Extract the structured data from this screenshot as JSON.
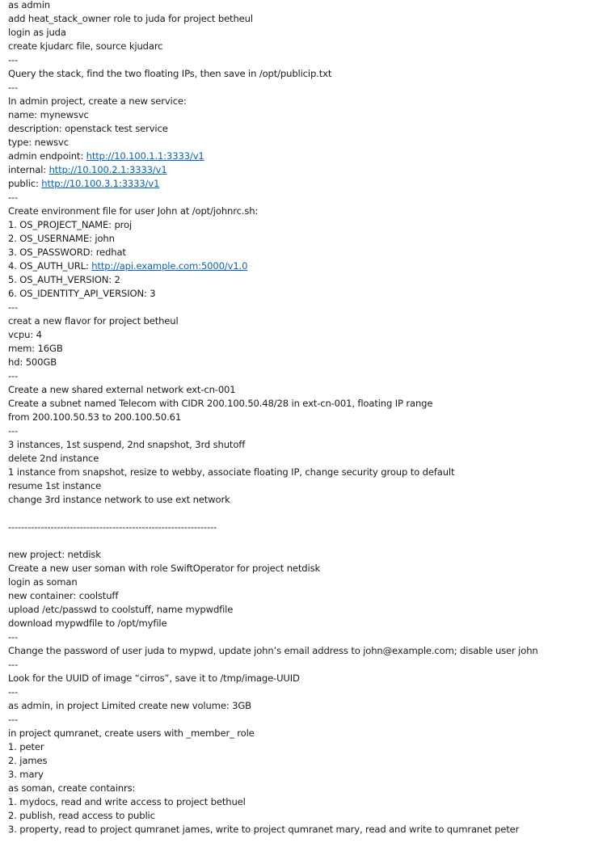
{
  "lines": [
    [
      {
        "t": "as admin"
      }
    ],
    [
      {
        "t": "add heat_stack_owner role to juda for project betheul"
      }
    ],
    [
      {
        "t": "login as juda"
      }
    ],
    [
      {
        "t": "create kjudarc file, source kjudarc"
      }
    ],
    [
      {
        "t": "---"
      }
    ],
    [
      {
        "t": "Query the stack, find the two floating IPs, then save in /opt/publicip.txt"
      }
    ],
    [
      {
        "t": "---"
      }
    ],
    [
      {
        "t": "In admin project, create a new service:"
      }
    ],
    [
      {
        "t": "name: mynewsvc"
      }
    ],
    [
      {
        "t": "description: openstack test service"
      }
    ],
    [
      {
        "t": "type: newsvc"
      }
    ],
    [
      {
        "t": "admin endpoint: "
      },
      {
        "t": "http://10.100.1.1:3333/v1",
        "link": true
      }
    ],
    [
      {
        "t": "internal: "
      },
      {
        "t": "http://10.100.2.1:3333/v1",
        "link": true
      }
    ],
    [
      {
        "t": "public: "
      },
      {
        "t": "http://10.100.3.1:3333/v1",
        "link": true
      }
    ],
    [
      {
        "t": "---"
      }
    ],
    [
      {
        "t": "Create environment file for user John at /opt/johnrc.sh:"
      }
    ],
    [
      {
        "t": "1. OS_PROJECT_NAME: proj"
      }
    ],
    [
      {
        "t": "2. OS_USERNAME: john"
      }
    ],
    [
      {
        "t": "3. OS_PASSWORD: redhat"
      }
    ],
    [
      {
        "t": "4. OS_AUTH_URL: "
      },
      {
        "t": "http://api.example.com:5000/v1.0",
        "link": true
      }
    ],
    [
      {
        "t": "5. OS_AUTH_VERSION: 2"
      }
    ],
    [
      {
        "t": "6. OS_IDENTITY_API_VERSION: 3"
      }
    ],
    [
      {
        "t": "---"
      }
    ],
    [
      {
        "t": "creat a new flavor for project betheul"
      }
    ],
    [
      {
        "t": "vcpu: 4"
      }
    ],
    [
      {
        "t": "mem: 16GB"
      }
    ],
    [
      {
        "t": "hd: 500GB"
      }
    ],
    [
      {
        "t": "---"
      }
    ],
    [
      {
        "t": "Create a new shared external network ext-cn-001"
      }
    ],
    [
      {
        "t": "Create a subnet named Telecom with CIDR 200.100.50.48/28 in ext-cn-001, floating IP range"
      }
    ],
    [
      {
        "t": "from 200.100.50.53 to 200.100.50.61"
      }
    ],
    [
      {
        "t": "---"
      }
    ],
    [
      {
        "t": "3 instances, 1st suspend, 2nd snapshot, 3rd shutoff"
      }
    ],
    [
      {
        "t": "delete 2nd instance"
      }
    ],
    [
      {
        "t": "1 instance from snapshot, resize to webby, associate floating IP, change security group to default"
      }
    ],
    [
      {
        "t": "resume 1st instance"
      }
    ],
    [
      {
        "t": "change 3rd instance network to use ext network"
      }
    ],
    [
      {
        "t": ""
      }
    ],
    [
      {
        "t": "----------------------------------------------------------------"
      }
    ],
    [
      {
        "t": ""
      }
    ],
    [
      {
        "t": "new project: netdisk"
      }
    ],
    [
      {
        "t": "Create a new user soman with role SwiftOperator for project netdisk"
      }
    ],
    [
      {
        "t": "login as soman"
      }
    ],
    [
      {
        "t": "new container: coolstuff"
      }
    ],
    [
      {
        "t": "upload /etc/passwd to coolstuff, name mypwdfile"
      }
    ],
    [
      {
        "t": "download mypwdfile to /opt/myfile"
      }
    ],
    [
      {
        "t": "---"
      }
    ],
    [
      {
        "t": "Change the password of user juda to mypwd, update john’s email address to john@example.com; disable user john"
      }
    ],
    [
      {
        "t": "---"
      }
    ],
    [
      {
        "t": "Look for the UUID of image “cirros”, save it to /tmp/image-UUID"
      }
    ],
    [
      {
        "t": "---"
      }
    ],
    [
      {
        "t": "as admin, in project Limited create new volume: 3GB"
      }
    ],
    [
      {
        "t": "---"
      }
    ],
    [
      {
        "t": "in project qumranet, create users with _member_ role"
      }
    ],
    [
      {
        "t": "1. peter"
      }
    ],
    [
      {
        "t": "2. james"
      }
    ],
    [
      {
        "t": "3. mary"
      }
    ],
    [
      {
        "t": "as soman, create containrs:"
      }
    ],
    [
      {
        "t": "1. mydocs, read and write access to project bethuel"
      }
    ],
    [
      {
        "t": "2. publish, read access to public"
      }
    ],
    [
      {
        "t": "3. property, read to project qumranet james, write to project qumranet mary, read and write to qumranet peter"
      }
    ]
  ]
}
